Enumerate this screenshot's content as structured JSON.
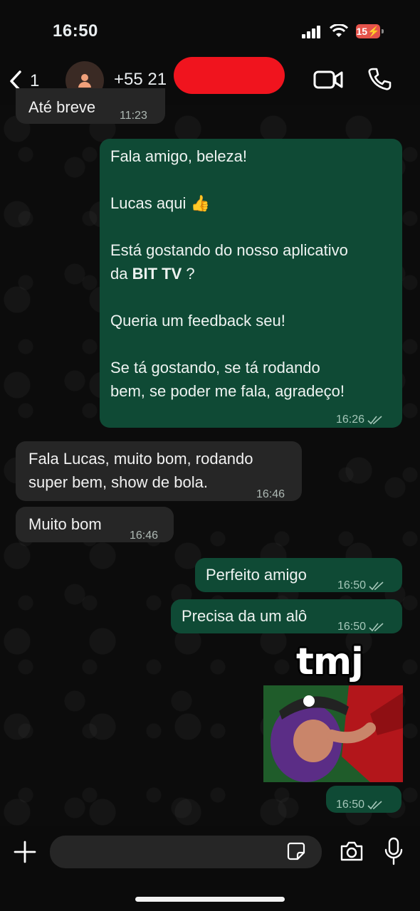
{
  "status_bar": {
    "time": "16:50",
    "battery": "15"
  },
  "header": {
    "back_count": "1",
    "contact": "+55 21"
  },
  "messages": [
    {
      "dir": "in",
      "text": "Até breve",
      "time": "11:23"
    },
    {
      "dir": "out",
      "text": "Fala amigo, beleza!\n\nLucas aqui 👍\n\nEstá gostando do nosso aplicativo\nda ",
      "bold": "BIT TV",
      "text_after": " ?\n\nQueria um feedback seu!\n\nSe tá gostando, se tá rodando\nbem, se poder me fala, agradeço!",
      "time": "16:26"
    },
    {
      "dir": "in",
      "text": "Fala Lucas, muito bom, rodando\nsuper bem, show de bola.",
      "time": "16:46"
    },
    {
      "dir": "in",
      "text": "Muito bom",
      "time": "16:46"
    },
    {
      "dir": "out",
      "text": "Perfeito amigo",
      "time": "16:50"
    },
    {
      "dir": "out",
      "text": "Precisa da um alô",
      "time": "16:50"
    },
    {
      "dir": "out",
      "sticker_text": "tmj",
      "time": "16:50"
    }
  ],
  "colors": {
    "out_bubble": "#0f4a35",
    "in_bubble": "#262626",
    "redaction": "#f0141e"
  }
}
